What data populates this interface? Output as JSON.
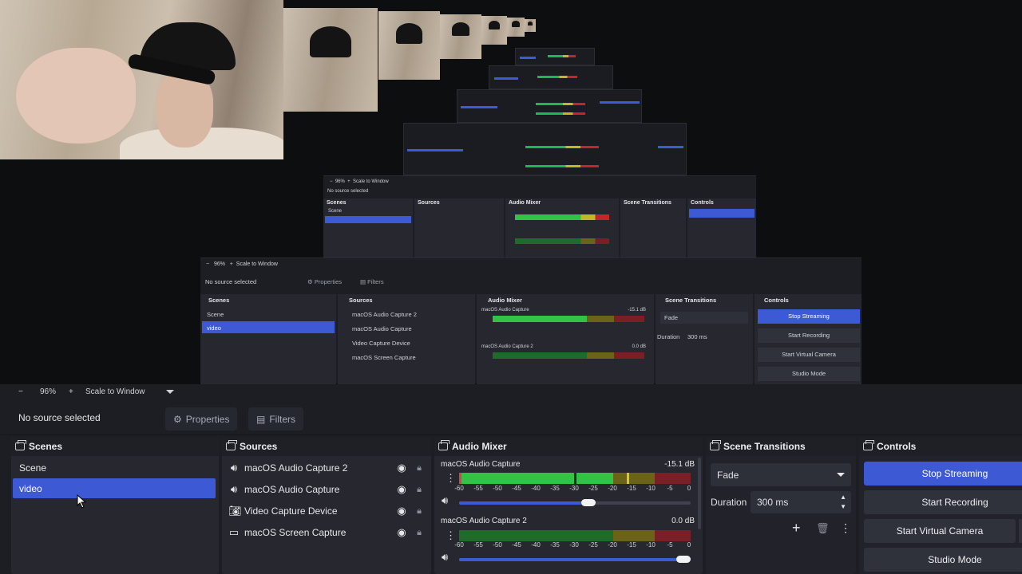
{
  "preview": {
    "nested_levels": [
      {
        "toolbar": {
          "zoom_minus": "−",
          "zoom": "96%",
          "zoom_plus": "+",
          "scale_mode": "Scale to Window"
        },
        "no_source": "No source selected",
        "properties": "Properties",
        "filters": "Filters",
        "docks": {
          "scenes": "Scenes",
          "sources": "Sources",
          "mixer": "Audio Mixer",
          "transitions": "Scene Transitions",
          "controls": "Controls"
        },
        "scenes": [
          "Scene",
          "video"
        ],
        "sources": [
          "macOS Audio Capture 2",
          "macOS Audio Capture",
          "Video Capture Device",
          "macOS Screen Capture"
        ],
        "mixer": [
          {
            "name": "macOS Audio Capture",
            "db": "-15.1 dB"
          },
          {
            "name": "macOS Audio Capture 2",
            "db": "0.0 dB"
          }
        ],
        "transition": "Fade",
        "duration_label": "Duration",
        "duration": "300 ms",
        "controls": [
          "Stop Streaming",
          "Start Recording",
          "Start Virtual Camera",
          "Studio Mode"
        ]
      }
    ]
  },
  "toolbar": {
    "zoom_minus": "−",
    "zoom": "96%",
    "zoom_plus": "+",
    "scale_mode": "Scale to Window"
  },
  "source_bar": {
    "no_source": "No source selected",
    "properties": "Properties",
    "filters": "Filters"
  },
  "scenes": {
    "title": "Scenes",
    "items": [
      "Scene",
      "video"
    ],
    "selected": "video"
  },
  "sources": {
    "title": "Sources",
    "items": [
      {
        "label": "macOS Audio Capture 2",
        "icon": "speaker-icon"
      },
      {
        "label": "macOS Audio Capture",
        "icon": "speaker-icon"
      },
      {
        "label": "Video Capture Device",
        "icon": "camera-icon"
      },
      {
        "label": "macOS Screen Capture",
        "icon": "monitor-icon"
      }
    ]
  },
  "mixer": {
    "title": "Audio Mixer",
    "ticks": [
      "-60",
      "-55",
      "-50",
      "-45",
      "-40",
      "-35",
      "-30",
      "-25",
      "-20",
      "-15",
      "-10",
      "-5",
      "0"
    ],
    "channels": [
      {
        "name": "macOS Audio Capture",
        "db": "-15.1 dB",
        "volume": 0.56
      },
      {
        "name": "macOS Audio Capture 2",
        "db": "0.0 dB",
        "volume": 1.0
      }
    ]
  },
  "transitions": {
    "title": "Scene Transitions",
    "selected": "Fade",
    "duration_label": "Duration",
    "duration": "300 ms"
  },
  "controls": {
    "title": "Controls",
    "buttons": [
      "Stop Streaming",
      "Start Recording",
      "Start Virtual Camera",
      "Studio Mode"
    ]
  },
  "colors": {
    "accent": "#3d59d4",
    "panel": "#27282f",
    "background": "#1d1e23"
  }
}
